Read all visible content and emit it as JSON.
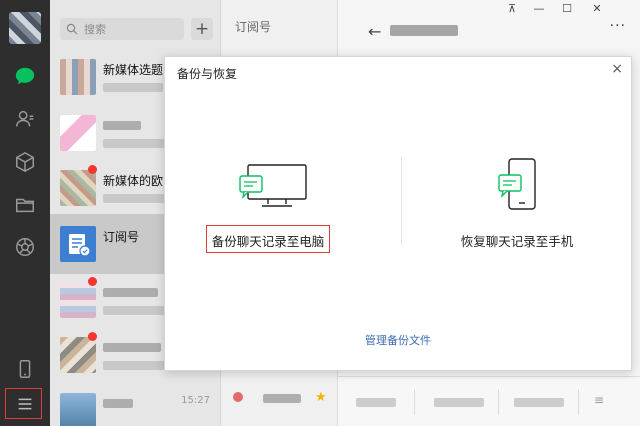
{
  "colors": {
    "accent_green": "#07c160",
    "highlight_red": "#e23b3b",
    "link_blue": "#3d6cb3",
    "badge_red": "#f43530"
  },
  "sidebar": {
    "icons": [
      "chat-icon",
      "contacts-icon",
      "favorites-cube-icon",
      "folder-icon",
      "moments-icon",
      "phone-icon",
      "menu-icon"
    ]
  },
  "convlist": {
    "search_placeholder": "搜索",
    "add_label": "+",
    "items": [
      {
        "name": "新媒体选题"
      },
      {
        "name": ""
      },
      {
        "name": "新媒体的欧"
      },
      {
        "name": "订阅号"
      },
      {
        "name": ""
      },
      {
        "name": ""
      },
      {
        "name": "",
        "time": "15:27"
      }
    ]
  },
  "midcol": {
    "title": "订阅号"
  },
  "window": {
    "pin": "⊼",
    "minimize": "—",
    "maximize": "☐",
    "close": "✕",
    "back": "←",
    "more": "···"
  },
  "dialog": {
    "title": "备份与恢复",
    "close": "×",
    "backup_label": "备份聊天记录至电脑",
    "restore_label": "恢复聊天记录至手机",
    "manage_link": "管理备份文件"
  }
}
